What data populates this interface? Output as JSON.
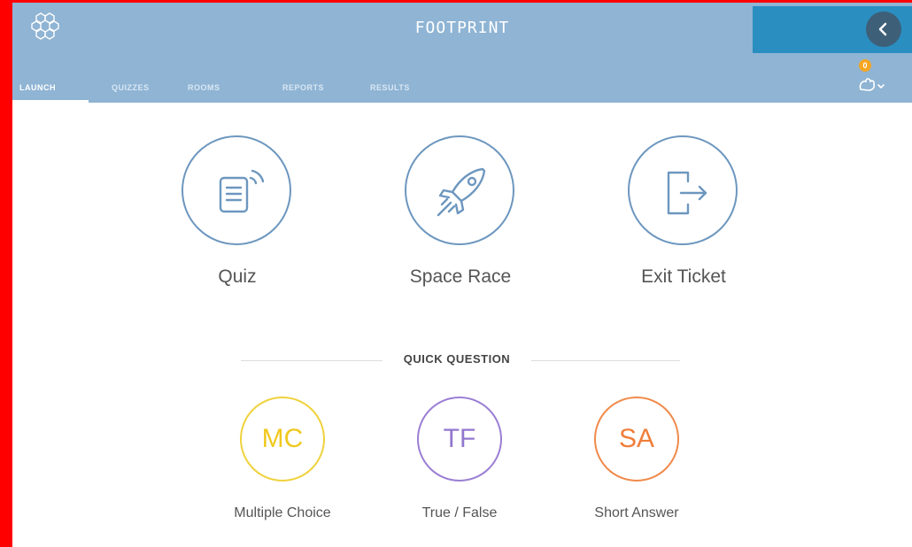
{
  "header": {
    "brand": "FOOTPRINT",
    "logo_icon": "hexagon-cluster-icon",
    "back_icon": "chevron-left-icon",
    "colors": {
      "bar": "#8fb4d4",
      "back_panel": "#2a8ec0",
      "back_button": "#3e5f78",
      "badge": "#f5a623"
    }
  },
  "tabs": [
    {
      "label": "LAUNCH",
      "active": true
    },
    {
      "label": "QUIZZES",
      "active": false
    },
    {
      "label": "ROOMS",
      "active": false
    },
    {
      "label": "REPORTS",
      "active": false
    },
    {
      "label": "RESULTS",
      "active": false
    }
  ],
  "notifications": {
    "count": "0",
    "icon": "hand-raise-icon",
    "dropdown_icon": "chevron-down-icon"
  },
  "launch": [
    {
      "label": "Quiz",
      "icon": "document-broadcast-icon"
    },
    {
      "label": "Space Race",
      "icon": "rocket-icon"
    },
    {
      "label": "Exit Ticket",
      "icon": "exit-door-icon"
    }
  ],
  "quick_question": {
    "title": "QUICK QUESTION",
    "options": [
      {
        "abbr": "MC",
        "label": "Multiple Choice",
        "color": "#f0d23c"
      },
      {
        "abbr": "TF",
        "label": "True / False",
        "color": "#9b7fd4"
      },
      {
        "abbr": "SA",
        "label": "Short Answer",
        "color": "#f08a4b"
      }
    ]
  }
}
